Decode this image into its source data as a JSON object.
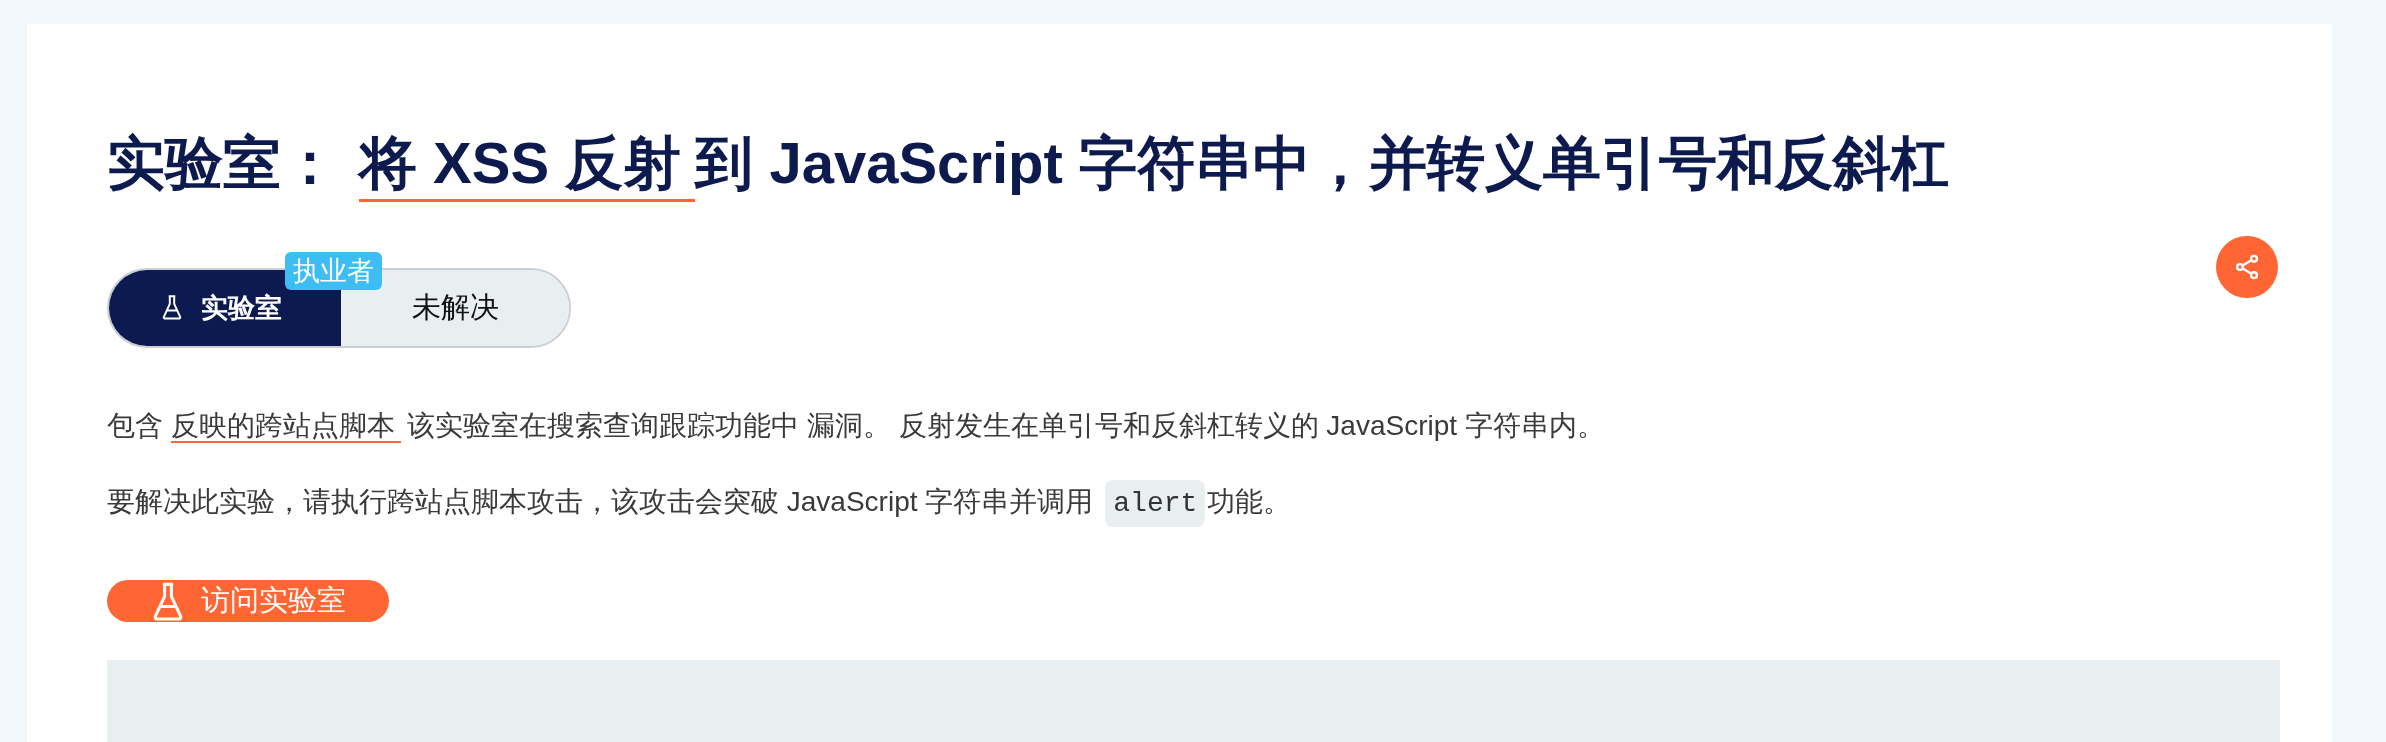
{
  "title": {
    "prefix": "实验室：",
    "link": "将 XSS 反射",
    "suffix": "到 JavaScript 字符串中，并转义单引号和反斜杠"
  },
  "level_badge": "执业者",
  "lab_tag": {
    "label": "实验室"
  },
  "status": "未解决",
  "paragraphs": [
    [
      {
        "kind": "text",
        "text": "包含"
      },
      {
        "kind": "link",
        "text": "反映的跨站点脚本"
      },
      {
        "kind": "text",
        "text": "该实验室在搜索查询跟踪功能中 漏洞。 反射发生在单引号和反斜杠转义的 JavaScript 字符串内。"
      }
    ],
    [
      {
        "kind": "text",
        "text": "要解决此实验，请执行跨站点脚本攻击，该攻击会突破 JavaScript 字符串并调用"
      },
      {
        "kind": "code",
        "text": "alert"
      },
      {
        "kind": "text",
        "text": "功能。"
      }
    ]
  ],
  "button": {
    "label": "访问实验室"
  }
}
